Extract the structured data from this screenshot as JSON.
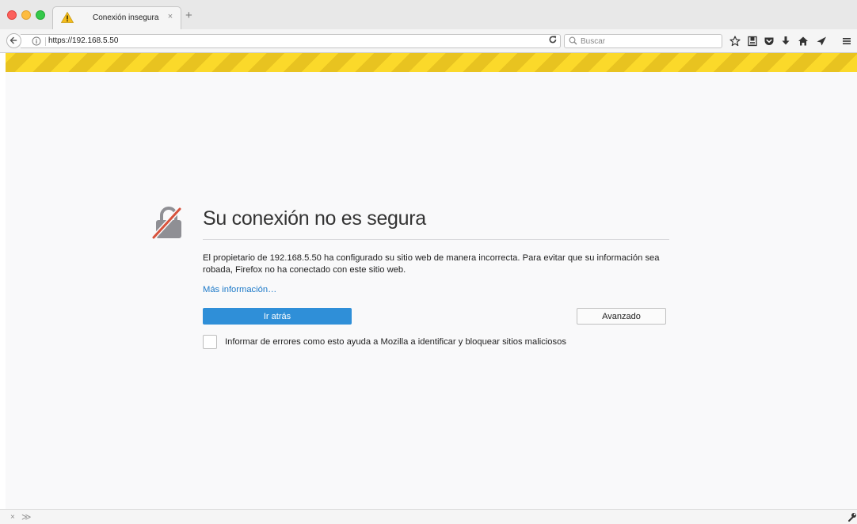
{
  "tab": {
    "title": "Conexión insegura",
    "close_glyph": "×",
    "icon": "warning-icon"
  },
  "new_tab_glyph": "+",
  "navbar": {
    "url": "https://192.168.5.50",
    "search_placeholder": "Buscar",
    "icons": [
      "back-icon",
      "info-icon",
      "reload-icon",
      "search-icon",
      "bookmark-star-icon",
      "reading-list-icon",
      "pocket-icon",
      "download-icon",
      "home-icon",
      "send-icon",
      "menu-icon"
    ]
  },
  "error": {
    "title": "Su conexión no es segura",
    "description": "El propietario de 192.168.5.50 ha configurado su sitio web de manera incorrecta. Para evitar que su información sea robada, Firefox no ha conectado con este sitio web.",
    "more_info": "Más información…",
    "go_back": "Ir atrás",
    "advanced": "Avanzado",
    "report_label": "Informar de errores como esto ayuda a Mozilla a identificar y bloquear sitios maliciosos",
    "report_checked": false
  },
  "bottombar": {
    "close_glyph": "×",
    "chevron_glyph": "≫"
  },
  "colors": {
    "hazard_yellow": "#fbd92a",
    "primary_button": "#2f8fd8",
    "link": "#1c79c8",
    "lock_strike": "#d7523c"
  }
}
